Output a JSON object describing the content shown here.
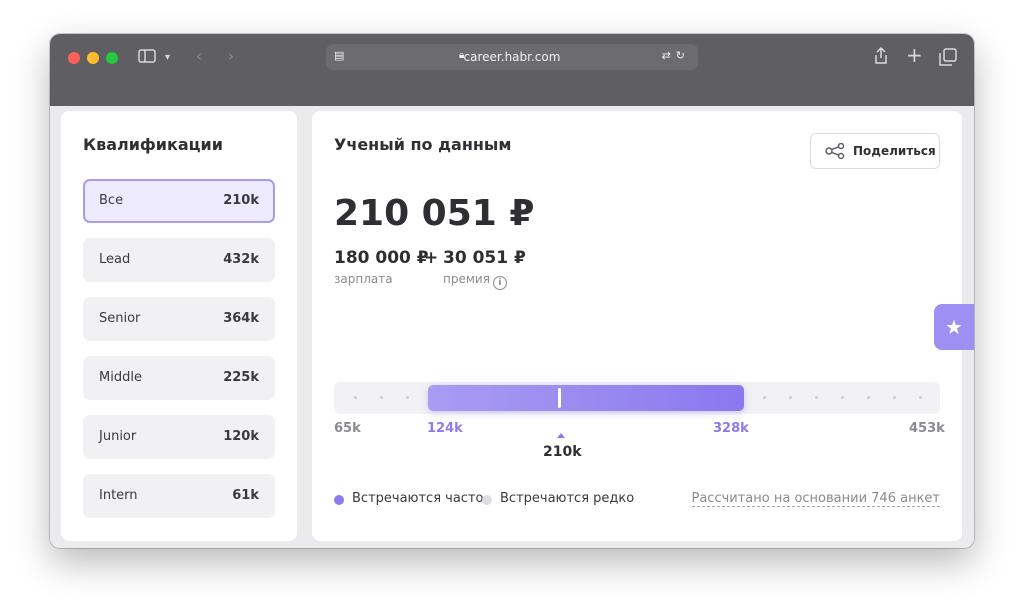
{
  "browser": {
    "url": "career.habr.com",
    "lock_icon": "lock-icon",
    "tab_icons": [
      "sidebar-icon",
      "chevron-down-icon",
      "back-icon",
      "forward-icon"
    ],
    "right_icons": [
      "share-icon",
      "plus-icon",
      "tabs-icon"
    ]
  },
  "qualifications": {
    "title": "Квалификации",
    "items": [
      {
        "label": "Все",
        "value": "210k",
        "active": true
      },
      {
        "label": "Lead",
        "value": "432k",
        "active": false
      },
      {
        "label": "Senior",
        "value": "364k",
        "active": false
      },
      {
        "label": "Middle",
        "value": "225k",
        "active": false
      },
      {
        "label": "Junior",
        "value": "120k",
        "active": false
      },
      {
        "label": "Intern",
        "value": "61k",
        "active": false
      }
    ]
  },
  "salary": {
    "title": "Ученый по данным",
    "share_label": "Поделиться",
    "total": "210 051 ₽",
    "salary_value": "180 000 ₽",
    "plus": "+",
    "bonus_value": "30 051 ₽",
    "salary_label": "зарплата",
    "bonus_label": "премия",
    "info_glyph": "i",
    "range": {
      "min": "65k",
      "low": "124k",
      "high": "328k",
      "max": "453k",
      "median": "210k"
    },
    "legend": {
      "frequent": "Встречаются часто",
      "rare": "Встречаются редко",
      "basis": "Рассчитано на основании 746 анкет"
    },
    "colors": {
      "accent": "#8b7bf0",
      "rare_dot": "#dcdce2"
    }
  },
  "favorite_icon": "star-icon"
}
